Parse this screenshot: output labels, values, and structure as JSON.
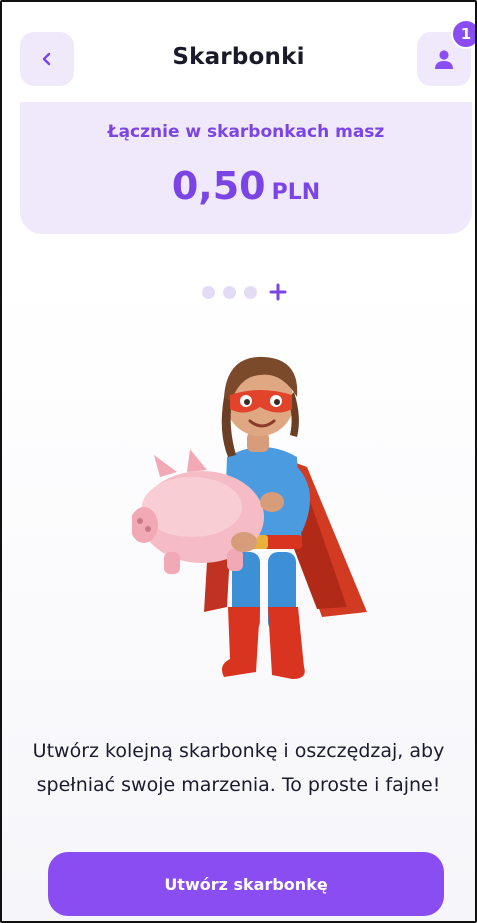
{
  "header": {
    "title": "Skarbonki",
    "back_icon": "chevron-left-icon",
    "profile_icon": "user-icon",
    "notification_count": "1"
  },
  "summary": {
    "label": "Łącznie w skarbonkach masz",
    "amount": "0,50",
    "currency": "PLN"
  },
  "pager": {
    "dot_count": 3,
    "add_icon": "plus-icon"
  },
  "main": {
    "description": "Utwórz kolejną skarbonkę i oszczędzaj, aby spełniać swoje marzenia. To proste i fajne!",
    "cta_label": "Utwórz skarbonkę"
  },
  "colors": {
    "accent": "#8a4df2",
    "accent_text": "#7b45e6",
    "card_bg": "#efe9fb",
    "dot_inactive": "#e4dcf7"
  }
}
